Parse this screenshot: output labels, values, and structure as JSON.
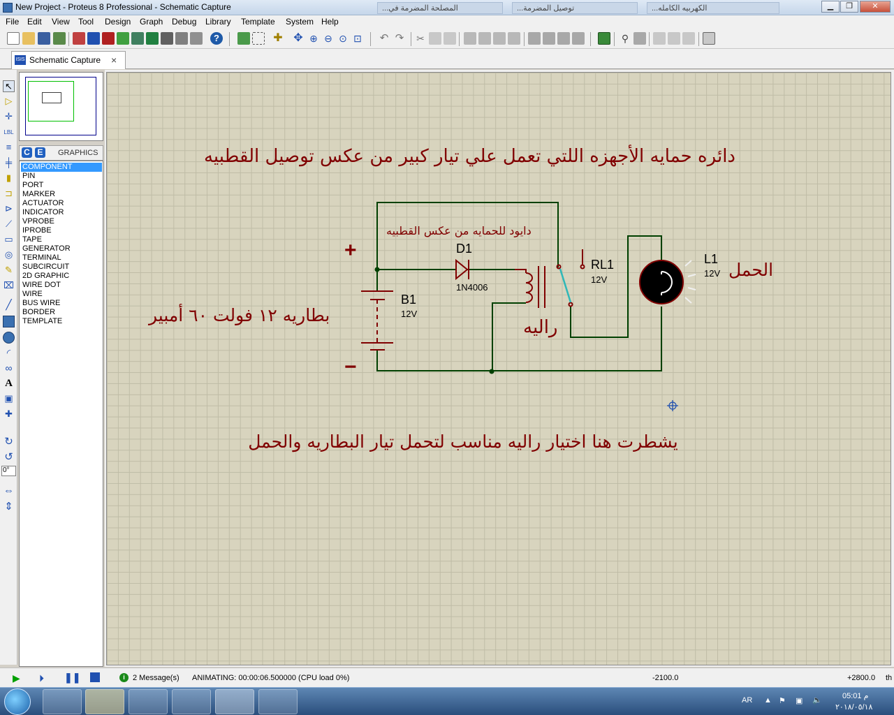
{
  "window": {
    "title": "New Project - Proteus 8 Professional - Schematic Capture",
    "bg_tabs": [
      "...المصلحة المضرمة في",
      "...توصيل المضرمة",
      "...الكهربيه الكامله"
    ],
    "buttons": {
      "minimize": "▁",
      "maximize": "❐",
      "close": "✕"
    }
  },
  "menu": [
    "File",
    "Edit",
    "View",
    "Tool",
    "Design",
    "Graph",
    "Debug",
    "Library",
    "Template",
    "System",
    "Help"
  ],
  "doc_tab": {
    "icon": "ISIS",
    "label": "Schematic Capture",
    "close": "×"
  },
  "device_selector": {
    "mode_c": "C",
    "mode_e": "E",
    "title": "GRAPHICS",
    "items": [
      "COMPONENT",
      "PIN",
      "PORT",
      "MARKER",
      "ACTUATOR",
      "INDICATOR",
      "VPROBE",
      "IPROBE",
      "TAPE",
      "GENERATOR",
      "TERMINAL",
      "SUBCIRCUIT",
      "2D GRAPHIC",
      "WIRE DOT",
      "WIRE",
      "BUS WIRE",
      "BORDER",
      "TEMPLATE"
    ],
    "selected_index": 0
  },
  "rotation": "0°",
  "schematic": {
    "heading": "دائره حمايه الأجهزه اللتي تعمل علي تيار كبير من عكس توصيل القطبيه",
    "diode_note": "دايود للحمايه من عكس القطبيه",
    "diode_ref": "D1",
    "diode_part": "1N4006",
    "battery_ref": "B1",
    "battery_value": "12V",
    "battery_note": "بطاريه ١٢ فولت ٦٠ أمبير",
    "plus": "+",
    "minus": "−",
    "relay_ref": "RL1",
    "relay_value": "12V",
    "relay_note": "راليه",
    "lamp_ref": "L1",
    "lamp_value": "12V",
    "lamp_note": "الحمل",
    "footer_note": "يشطرت هنا اختيار راليه مناسب لتحمل تيار البطاريه والحمل",
    "colors": {
      "wire": "#004000",
      "component": "#800000",
      "text": "#800000",
      "switch": "#2fb8b8"
    }
  },
  "status": {
    "messages": "2 Message(s)",
    "animating": "ANIMATING: 00:00:06.500000 (CPU load 0%)",
    "x_coord": "-2100.0",
    "y_coord": "+2800.0",
    "unit": "th"
  },
  "taskbar": {
    "lang": "AR",
    "time": "05:01 م",
    "date": "٢٠١٨/٠٥/١٨"
  }
}
